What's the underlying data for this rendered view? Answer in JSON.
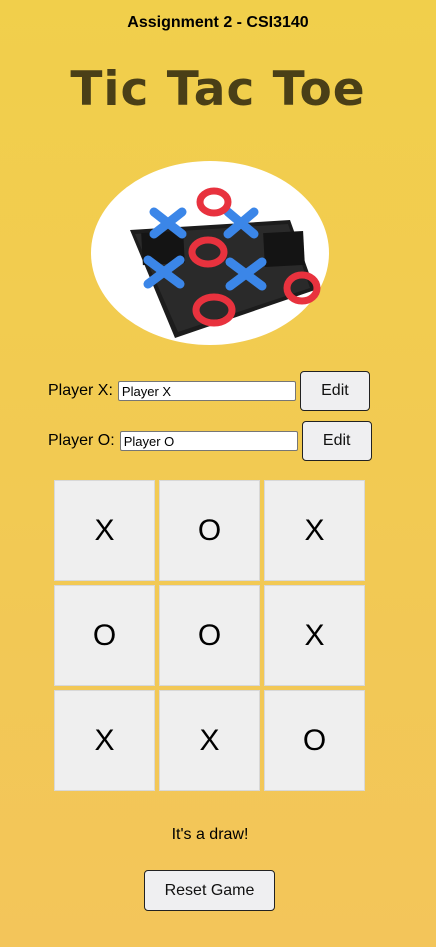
{
  "header": {
    "assignment": "Assignment 2 - CSI3140",
    "title": "Tic Tac Toe"
  },
  "players": {
    "x": {
      "label": "Player X:",
      "value": "Player X",
      "edit_label": "Edit"
    },
    "o": {
      "label": "Player O:",
      "value": "Player O",
      "edit_label": "Edit"
    }
  },
  "board": {
    "cells": [
      "X",
      "O",
      "X",
      "O",
      "O",
      "X",
      "X",
      "X",
      "O"
    ]
  },
  "status": "It's a draw!",
  "reset_label": "Reset Game"
}
